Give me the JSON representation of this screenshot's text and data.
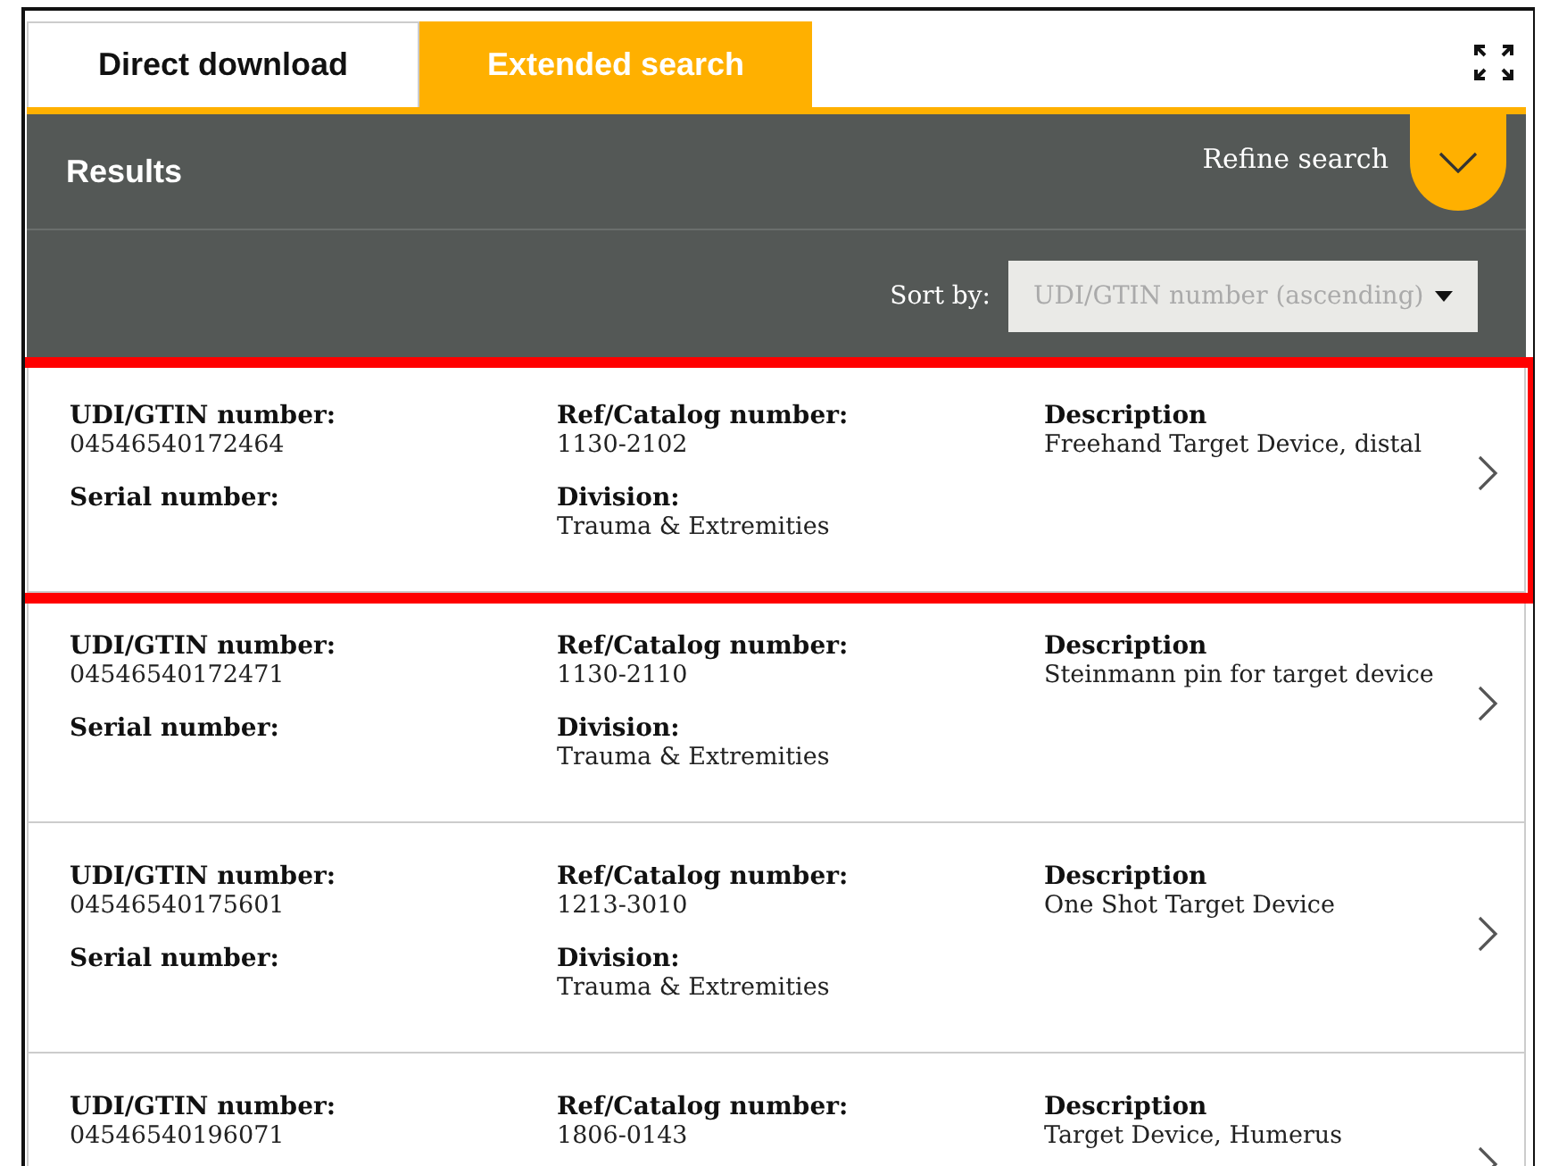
{
  "tabs": [
    {
      "label": "Direct download",
      "selected": false
    },
    {
      "label": "Extended search",
      "selected": true
    }
  ],
  "header": {
    "title": "Results",
    "refine_label": "Refine search"
  },
  "sort": {
    "label": "Sort by:",
    "value": "UDI/GTIN number (ascending)"
  },
  "results": [
    {
      "highlighted": true,
      "fields": [
        {
          "label": "UDI/GTIN number:",
          "value": "04546540172464"
        },
        {
          "label": "Ref/Catalog number:",
          "value": "1130-2102"
        },
        {
          "label": "Description",
          "value": "Freehand Target Device, distal"
        },
        {
          "label": "Serial number:"
        },
        {
          "label": "Division:",
          "value": "Trauma & Extremities"
        }
      ]
    },
    {
      "highlighted": false,
      "fields": [
        {
          "label": "UDI/GTIN number:",
          "value": "04546540172471"
        },
        {
          "label": "Ref/Catalog number:",
          "value": "1130-2110"
        },
        {
          "label": "Description",
          "value": "Steinmann pin for target device"
        },
        {
          "label": "Serial number:"
        },
        {
          "label": "Division:",
          "value": "Trauma & Extremities"
        }
      ]
    },
    {
      "highlighted": false,
      "fields": [
        {
          "label": "UDI/GTIN number:",
          "value": "04546540175601"
        },
        {
          "label": "Ref/Catalog number:",
          "value": "1213-3010"
        },
        {
          "label": "Description",
          "value": "One Shot Target Device"
        },
        {
          "label": "Serial number:"
        },
        {
          "label": "Division:",
          "value": "Trauma & Extremities"
        }
      ]
    },
    {
      "highlighted": false,
      "fields": [
        {
          "label": "UDI/GTIN number:",
          "value": "04546540196071"
        },
        {
          "label": "Ref/Catalog number:",
          "value": "1806-0143"
        },
        {
          "label": "Description",
          "value": "Target Device, Humerus"
        }
      ]
    }
  ]
}
